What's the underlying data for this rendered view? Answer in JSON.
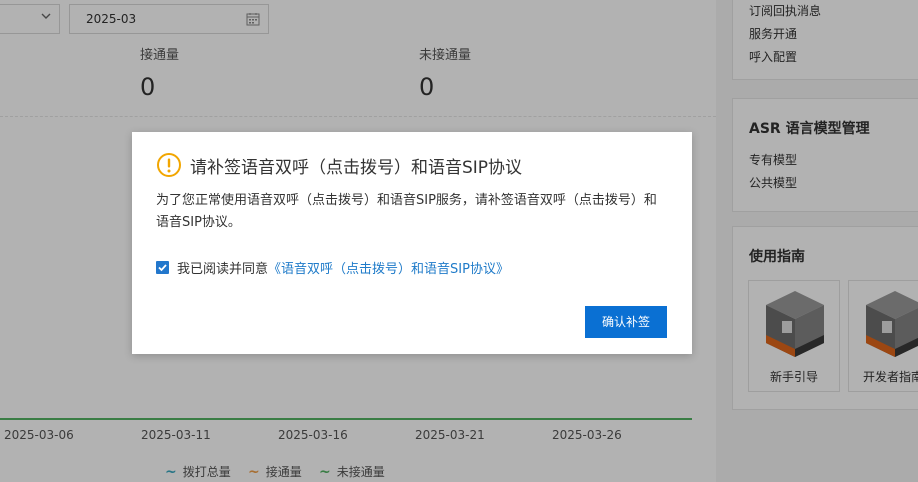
{
  "filters": {
    "date_value": "2025-03"
  },
  "stats": [
    {
      "label": "接通量",
      "value": "0"
    },
    {
      "label": "未接通量",
      "value": "0"
    }
  ],
  "chart": {
    "x_ticks": [
      "2025-03-06",
      "2025-03-11",
      "2025-03-16",
      "2025-03-21",
      "2025-03-26"
    ],
    "legend": [
      {
        "name": "拨打总量",
        "color": "#3aa8c1"
      },
      {
        "name": "接通量",
        "color": "#f0a04b"
      },
      {
        "name": "未接通量",
        "color": "#54b364"
      }
    ]
  },
  "right": {
    "top_items": [
      "订阅回执消息",
      "服务开通",
      "呼入配置"
    ],
    "asr": {
      "title": "ASR 语言模型管理",
      "items": [
        "专有模型",
        "公共模型"
      ]
    },
    "guide": {
      "title": "使用指南",
      "tiles": [
        "新手引导",
        "开发者指南"
      ]
    }
  },
  "modal": {
    "title": "请补签语音双呼（点击拨号）和语音SIP协议",
    "body": "为了您正常使用语音双呼（点击拨号）和语音SIP服务，请补签语音双呼（点击拨号）和语音SIP协议。",
    "agree_text": "我已阅读并同意",
    "agree_link": "《语音双呼（点击拨号）和语音SIP协议》",
    "confirm_label": "确认补签",
    "warn_color": "#f2a600",
    "accent_color": "#0a70d3"
  }
}
